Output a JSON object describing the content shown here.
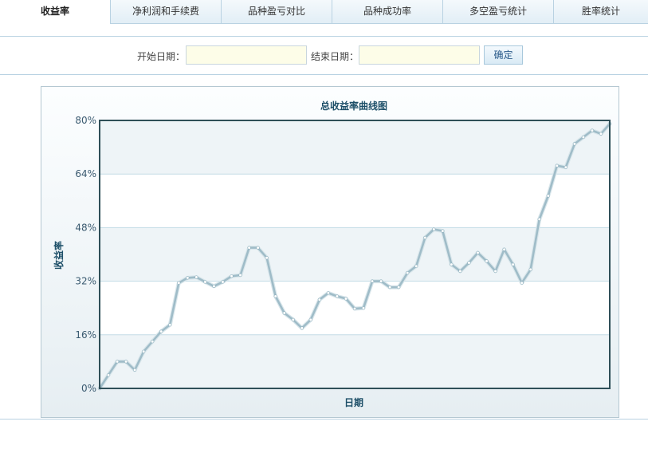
{
  "tabs": [
    {
      "label": "收益率",
      "active": true
    },
    {
      "label": "净利润和手续费",
      "active": false
    },
    {
      "label": "品种盈亏对比",
      "active": false
    },
    {
      "label": "品种成功率",
      "active": false
    },
    {
      "label": "多空盈亏统计",
      "active": false
    },
    {
      "label": "胜率统计",
      "active": false
    }
  ],
  "filter": {
    "start_label": "开始日期：",
    "end_label": "结束日期：",
    "start_value": "",
    "end_value": "",
    "confirm_label": "确定"
  },
  "colors": {
    "line": "#9fbcc8",
    "point": "#ffffff",
    "frame": "#2f4f58",
    "title": "#1d4f68",
    "band": "#eef4f7"
  },
  "chart_data": {
    "type": "line",
    "title": "总收益率曲线图",
    "xlabel": "日期",
    "ylabel": "收益率",
    "ylim": [
      0,
      80
    ],
    "y_ticks": [
      "0%",
      "16%",
      "32%",
      "48%",
      "64%",
      "80%"
    ],
    "y_tick_values": [
      0,
      16,
      32,
      48,
      64,
      80
    ],
    "grid": true,
    "series": [
      {
        "values": [
          0,
          4,
          8,
          8,
          5.5,
          11,
          14,
          17,
          19,
          31.5,
          33,
          33.2,
          31.8,
          30.5,
          31.8,
          33.5,
          33.8,
          42,
          42,
          39,
          27.5,
          22.5,
          20.5,
          18,
          20.5,
          26.5,
          28.5,
          27.5,
          26.8,
          23.8,
          24,
          32,
          32,
          30.2,
          30.2,
          34.5,
          36.5,
          45,
          47.5,
          47,
          37,
          35,
          37.5,
          40.5,
          38,
          35,
          41.5,
          37,
          31.5,
          35.5,
          50.5,
          57.5,
          66.5,
          66,
          73,
          75,
          77,
          76,
          79
        ]
      }
    ]
  }
}
